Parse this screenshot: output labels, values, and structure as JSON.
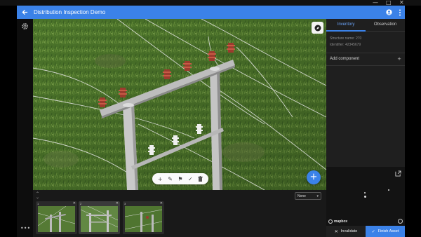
{
  "window": {
    "minimize_glyph": "—",
    "maximize_glyph": "□",
    "close_glyph": "✕"
  },
  "app": {
    "title": "Distribution Inspection Demo",
    "back_icon": "arrow-back-icon",
    "account_icon": "account-circle-icon",
    "menu_icon": "more-vert-icon",
    "accent_color": "#3b82e8"
  },
  "rail": {
    "settings_icon": "gear-icon",
    "more_label": "•••"
  },
  "toolbar": {
    "tools": [
      {
        "name": "add-tool",
        "glyph": "+"
      },
      {
        "name": "pencil-tool",
        "glyph": "✎"
      },
      {
        "name": "flag-tool",
        "glyph": "⚑"
      },
      {
        "name": "check-tool",
        "glyph": "✓"
      },
      {
        "name": "delete-tool",
        "glyph": "🗑"
      }
    ]
  },
  "filmstrip": {
    "toggle_glyph": "⌃⌄",
    "sort": {
      "selected": "None",
      "caret": "▾"
    },
    "thumbnails": [
      {
        "index": "1",
        "close": "✕",
        "selected": false
      },
      {
        "index": "2",
        "close": "✕",
        "selected": true
      },
      {
        "index": "3",
        "close": "✕",
        "selected": false
      }
    ]
  },
  "panel": {
    "tabs": [
      {
        "label": "Inventory",
        "active": true
      },
      {
        "label": "Observation",
        "active": false
      }
    ],
    "structure_name": "Structure name: 270",
    "identifier": "Identifier: 42345679",
    "add_component": "Add component",
    "add_glyph": "+"
  },
  "map": {
    "logo": "mapbox",
    "expand_icon": "open-in-new-icon"
  },
  "actions": {
    "invalidate": "Invalidate",
    "invalidate_glyph": "✕",
    "finish": "Finish Asset",
    "finish_glyph": "✓"
  }
}
